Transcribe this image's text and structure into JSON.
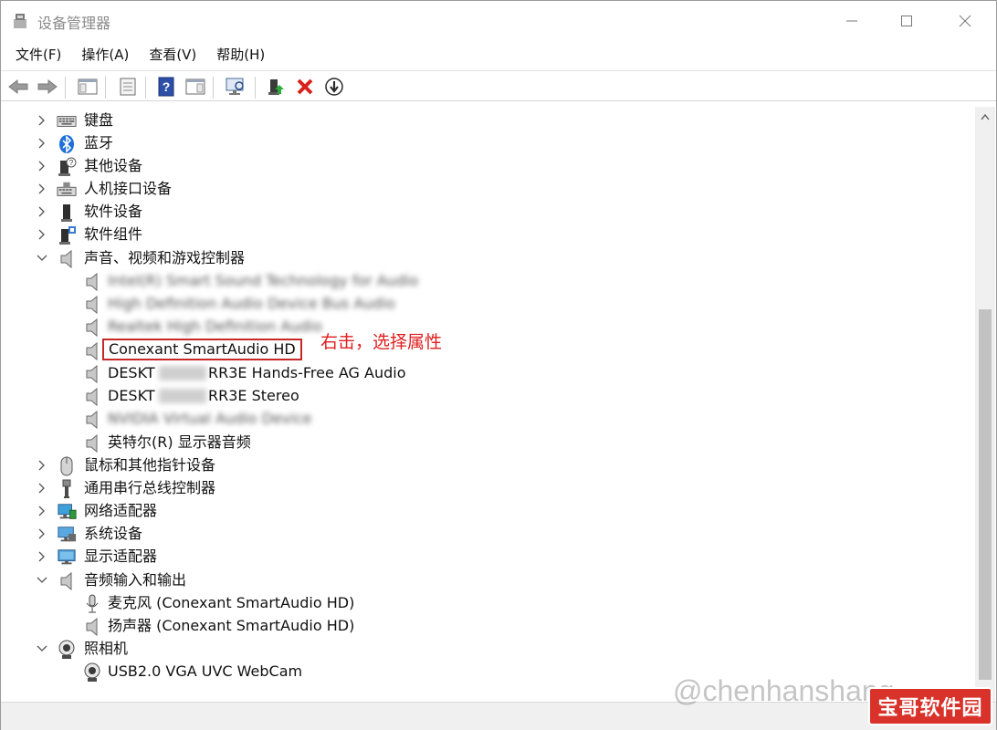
{
  "window": {
    "title": "设备管理器"
  },
  "menu": [
    "文件(F)",
    "操作(A)",
    "查看(V)",
    "帮助(H)"
  ],
  "tree": {
    "items": [
      {
        "label": "键盘",
        "icon": "keyboard-icon",
        "expanded": false
      },
      {
        "label": "蓝牙",
        "icon": "bluetooth-icon",
        "expanded": false
      },
      {
        "label": "其他设备",
        "icon": "other-device-icon",
        "expanded": false
      },
      {
        "label": "人机接口设备",
        "icon": "hid-icon",
        "expanded": false
      },
      {
        "label": "软件设备",
        "icon": "software-device-icon",
        "expanded": false
      },
      {
        "label": "软件组件",
        "icon": "software-component-icon",
        "expanded": false
      },
      {
        "label": "声音、视频和游戏控制器",
        "icon": "speaker-icon",
        "expanded": true
      },
      {
        "label": "Conexant SmartAudio HD",
        "icon": "speaker-icon"
      },
      {
        "label": "DESKT",
        "icon": "speaker-icon"
      },
      {
        "label": "RR3E Hands-Free AG Audio",
        "icon": "speaker-icon"
      },
      {
        "label": "RR3E Stereo",
        "icon": "speaker-icon"
      },
      {
        "label": "英特尔(R) 显示器音频",
        "icon": "speaker-icon"
      },
      {
        "label": "鼠标和其他指针设备",
        "icon": "mouse-icon",
        "expanded": false
      },
      {
        "label": "通用串行总线控制器",
        "icon": "usb-icon",
        "expanded": false
      },
      {
        "label": "网络适配器",
        "icon": "network-icon",
        "expanded": false
      },
      {
        "label": "系统设备",
        "icon": "system-device-icon",
        "expanded": false
      },
      {
        "label": "显示适配器",
        "icon": "display-adapter-icon",
        "expanded": false
      },
      {
        "label": "音频输入和输出",
        "icon": "speaker-icon",
        "expanded": true
      },
      {
        "label": "麦克风 (Conexant SmartAudio HD)",
        "icon": "microphone-icon"
      },
      {
        "label": "扬声器 (Conexant SmartAudio HD)",
        "icon": "speaker-icon"
      },
      {
        "label": "照相机",
        "icon": "camera-icon",
        "expanded": true
      },
      {
        "label": "USB2.0 VGA UVC WebCam",
        "icon": "camera-icon"
      }
    ],
    "blurred": [
      "Intel(R) Smart Sound Technology for Audio",
      "High Definition Audio Device Bus Audio",
      "Realtek High Definition Audio",
      "NVIDIA Virtual Audio Device"
    ]
  },
  "annotation": "右击，选择属性",
  "watermark": {
    "text": "@chenhanshang",
    "badge": "宝哥软件园"
  }
}
